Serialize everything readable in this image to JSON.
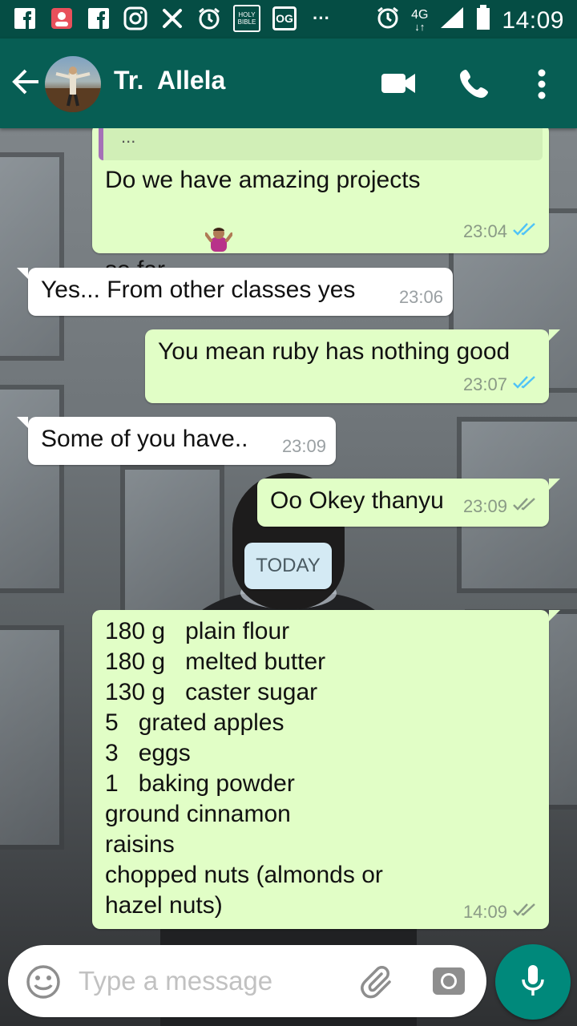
{
  "status_bar": {
    "time": "14:09",
    "network": "4G",
    "more": "···",
    "icons": [
      "facebook-icon",
      "badge-icon",
      "facebook-icon",
      "instagram-icon",
      "x-icon",
      "alarm-icon",
      "holy-bible-icon",
      "og-icon"
    ],
    "bible_label": "HOLY BIBLE",
    "og_label": "OG"
  },
  "header": {
    "contact_name": "Tr.  Allela",
    "icons": [
      "back-arrow-icon",
      "video-call-icon",
      "phone-icon",
      "more-vert-icon"
    ]
  },
  "messages": [
    {
      "direction": "out",
      "quote": "...",
      "text": "Do we have amazing projects\nso far",
      "emoji": "person-shrugging",
      "time": "23:04",
      "status": "read"
    },
    {
      "direction": "in",
      "text": "Yes... From other classes yes",
      "time": "23:06"
    },
    {
      "direction": "out",
      "text": "You mean ruby has nothing good",
      "time": "23:07",
      "status": "read"
    },
    {
      "direction": "in",
      "text": "Some of you have..",
      "time": "23:09"
    },
    {
      "direction": "out",
      "text": "Oo Okey thanyu",
      "time": "23:09",
      "status": "delivered"
    }
  ],
  "date_divider": "TODAY",
  "recipe_message": {
    "direction": "out",
    "lines": [
      "180 g   plain flour",
      "180 g   melted butter",
      "130 g   caster sugar",
      "5   grated apples",
      "3   eggs",
      "1   baking powder",
      "ground cinnamon",
      "raisins",
      "chopped nuts (almonds or",
      "hazel nuts)"
    ],
    "time": "14:09",
    "status": "delivered"
  },
  "input": {
    "placeholder": "Type a message",
    "icons": [
      "emoji-icon",
      "attach-icon",
      "camera-icon",
      "mic-icon"
    ]
  },
  "colors": {
    "header": "#075e54",
    "status_bar": "#054d44",
    "outgoing_bubble": "#e1fec6",
    "incoming_bubble": "#ffffff",
    "read_tick": "#4fc3f7",
    "mic_button": "#00897b"
  }
}
